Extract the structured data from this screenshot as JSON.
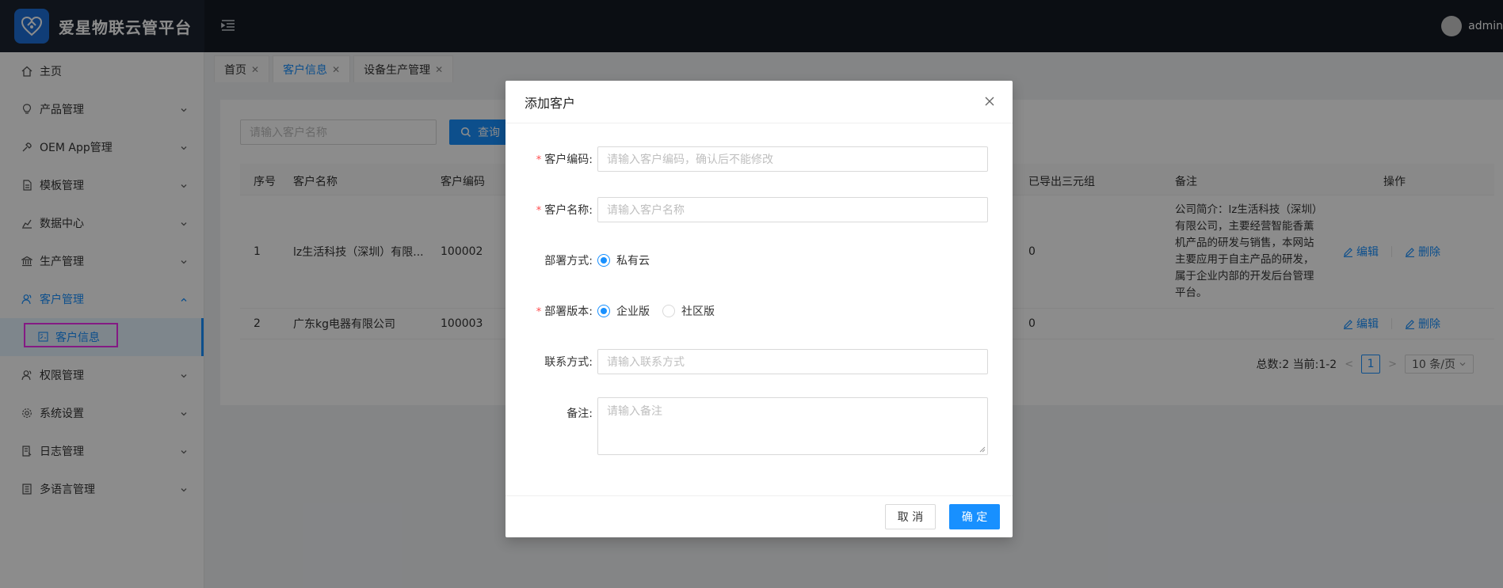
{
  "app": {
    "title": "爱星物联云管平台",
    "user": "admin"
  },
  "sidebar": {
    "items": [
      {
        "label": "主页",
        "icon": "home-icon"
      },
      {
        "label": "产品管理",
        "icon": "bulb-icon"
      },
      {
        "label": "OEM App管理",
        "icon": "tool-icon"
      },
      {
        "label": "模板管理",
        "icon": "file-icon"
      },
      {
        "label": "数据中心",
        "icon": "chart-icon"
      },
      {
        "label": "生产管理",
        "icon": "bank-icon"
      },
      {
        "label": "客户管理",
        "icon": "team-icon"
      },
      {
        "label": "权限管理",
        "icon": "team-icon"
      },
      {
        "label": "系统设置",
        "icon": "gear-icon"
      },
      {
        "label": "日志管理",
        "icon": "log-icon"
      },
      {
        "label": "多语言管理",
        "icon": "book-icon"
      }
    ],
    "sub_item": {
      "label": "客户信息",
      "icon": "profile-icon"
    }
  },
  "tabs": [
    {
      "label": "首页"
    },
    {
      "label": "客户信息"
    },
    {
      "label": "设备生产管理"
    }
  ],
  "search": {
    "placeholder": "请输入客户名称",
    "button": "查询"
  },
  "table": {
    "columns": [
      "序号",
      "客户名称",
      "客户编码",
      "已导出三元组",
      "备注",
      "操作"
    ],
    "rows": [
      {
        "index": "1",
        "name": "lz生活科技（深圳）有限...",
        "code": "100002",
        "exported": "0",
        "remark": "公司简介：lz生活科技（深圳）有限公司，主要经营智能香薰机产品的研发与销售，本网站主要应用于自主产品的研发，属于企业内部的开发后台管理平台。",
        "edit": "编辑",
        "delete": "删除"
      },
      {
        "index": "2",
        "name": "广东kg电器有限公司",
        "code": "100003",
        "exported": "0",
        "remark": "",
        "edit": "编辑",
        "delete": "删除"
      }
    ]
  },
  "pagination": {
    "summary": "总数:2 当前:1-2",
    "current": "1",
    "page_size": "10 条/页"
  },
  "modal": {
    "title": "添加客户",
    "fields": {
      "code": {
        "label": "客户编码:",
        "placeholder": "请输入客户编码，确认后不能修改"
      },
      "name": {
        "label": "客户名称:",
        "placeholder": "请输入客户名称"
      },
      "deploy": {
        "label": "部署方式:",
        "option": "私有云"
      },
      "version": {
        "label": "部署版本:",
        "option1": "企业版",
        "option2": "社区版"
      },
      "contact": {
        "label": "联系方式:",
        "placeholder": "请输入联系方式"
      },
      "remark": {
        "label": "备注:",
        "placeholder": "请输入备注"
      }
    },
    "cancel": "取 消",
    "ok": "确 定"
  },
  "colors": {
    "primary": "#1890ff",
    "header_bg": "#141a24",
    "required": "#ff4d4f",
    "highlight": "#f030f0"
  }
}
